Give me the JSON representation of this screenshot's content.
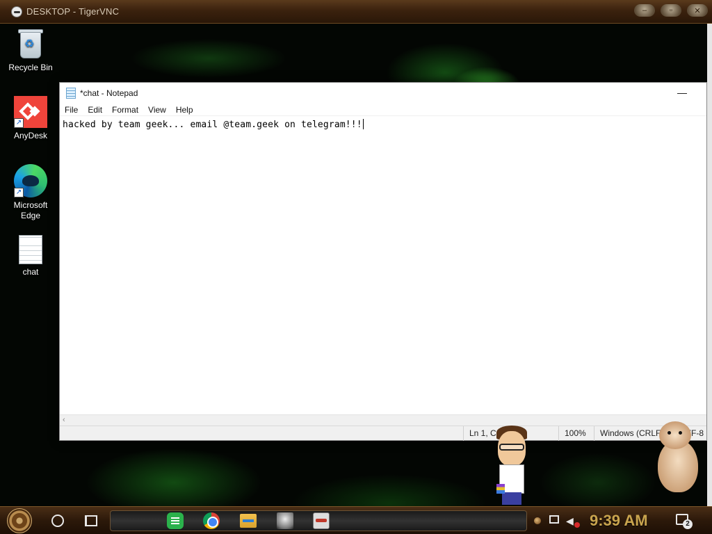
{
  "vnc": {
    "title": "DESKTOP - TigerVNC"
  },
  "desktop_icons": [
    {
      "label": "Recycle Bin",
      "icon": "recycle-bin-icon"
    },
    {
      "label": "AnyDesk",
      "icon": "anydesk-icon"
    },
    {
      "label": "Microsoft Edge",
      "icon": "edge-icon"
    },
    {
      "label": "chat",
      "icon": "text-file-icon"
    }
  ],
  "notepad": {
    "title": "*chat - Notepad",
    "minimize_glyph": "—",
    "menu": [
      "File",
      "Edit",
      "Format",
      "View",
      "Help"
    ],
    "content": "hacked by team geek... email @team.geek on telegram!!!",
    "status": {
      "position": "Ln 1, Col 56",
      "zoom": "100%",
      "line_ending": "Windows (CRLF)",
      "encoding": "UTF-8"
    }
  },
  "taskbar": {
    "apps": [
      "feedly-icon",
      "chrome-icon",
      "file-explorer-icon",
      "portrait-app-icon",
      "tigervnc-icon"
    ],
    "clock": "9:39 AM",
    "notification_count": "2"
  },
  "colors": {
    "clock": "#c9a44e",
    "taskbar": "#2c190a",
    "desktop_glow": "#3cc832"
  }
}
